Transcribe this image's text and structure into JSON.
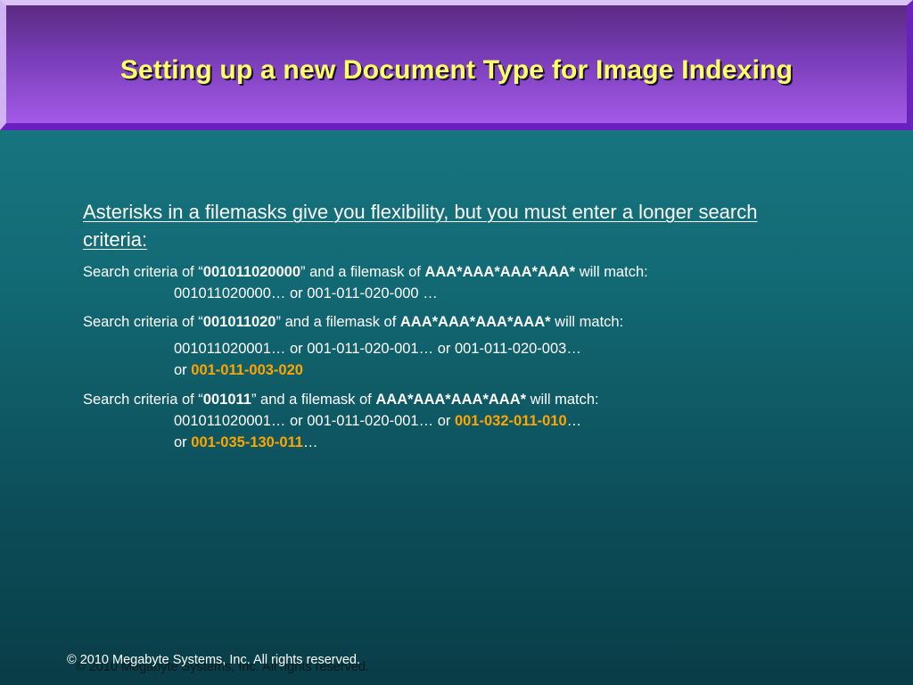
{
  "header": {
    "title": "Setting up a new Document Type for Image Indexing"
  },
  "content": {
    "heading": "Asterisks in a filemasks give you flexibility, but you must enter a longer search criteria:",
    "examples": [
      {
        "prefix": "Search criteria of “",
        "criteria": "001011020000",
        "middle": "” and a filemask of ",
        "mask": "AAA*AAA*AAA*AAA*",
        "suffix": " will match:",
        "matches_line1": "001011020000… or 001-011-020-000 …"
      },
      {
        "prefix": "Search criteria of “",
        "criteria": "001011020",
        "middle": "” and a filemask of ",
        "mask": "AAA*AAA*AAA*AAA*",
        "suffix": " will match:",
        "matches_line1": "001011020001… or 001-011-020-001… or 001-011-020-003…",
        "or_label": "or ",
        "highlight": "001-011-003-020"
      },
      {
        "prefix": "Search criteria of “",
        "criteria": "001011",
        "middle": "” and a filemask of ",
        "mask": "AAA*AAA*AAA*AAA*",
        "suffix": " will match:",
        "matches_line1_prefix": "001011020001… or 001-011-020-001… or ",
        "highlight1": "001-032-011-010",
        "ellipsis1": "…",
        "or_label": "or ",
        "highlight2": "001-035-130-011",
        "ellipsis2": "…"
      }
    ]
  },
  "footer": {
    "copyright": "© 2010 Megabyte Systems, Inc. All rights reserved."
  },
  "colors": {
    "title": "#ffff66",
    "highlight": "#ffa500",
    "header_band": "#7a3db8",
    "background": "#126a75"
  }
}
